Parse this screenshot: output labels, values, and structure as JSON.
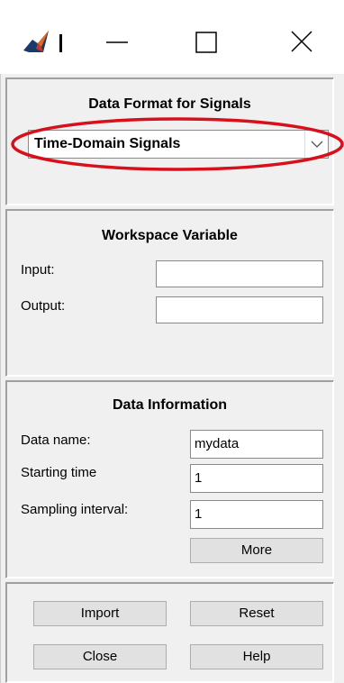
{
  "window": {
    "icons": [
      "matlab-logo-icon",
      "minimize-icon",
      "maximize-icon",
      "close-icon"
    ]
  },
  "format_panel": {
    "title": "Data Format for Signals",
    "selected": "Time-Domain Signals"
  },
  "workspace_panel": {
    "title": "Workspace Variable",
    "input_label": "Input:",
    "input_value": "",
    "output_label": "Output:",
    "output_value": ""
  },
  "info_panel": {
    "title": "Data Information",
    "name_label": "Data name:",
    "name_value": "mydata",
    "start_label": "Starting time",
    "start_value": "1",
    "interval_label": "Sampling interval:",
    "interval_value": "1",
    "more_label": "More"
  },
  "actions": {
    "import_label": "Import",
    "reset_label": "Reset",
    "close_label": "Close",
    "help_label": "Help"
  },
  "annotation": {
    "color": "#d8101c"
  }
}
